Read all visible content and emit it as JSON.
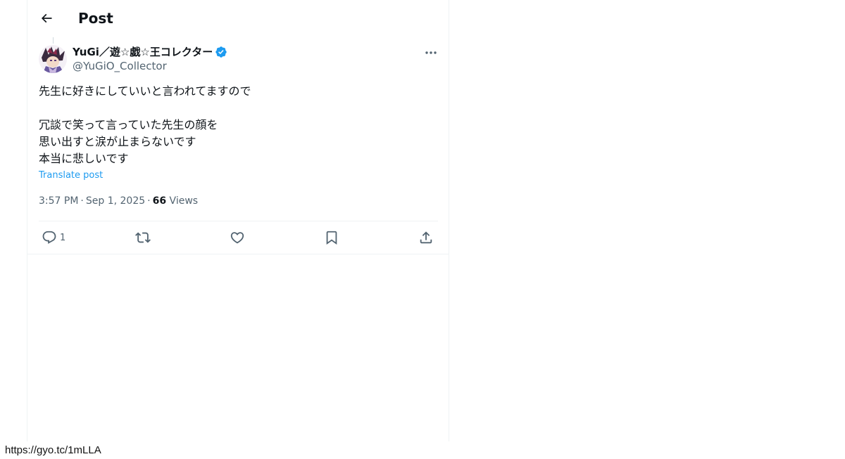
{
  "header": {
    "title": "Post",
    "back_icon": "arrow-left-icon"
  },
  "post": {
    "author": {
      "display_name": "YuGi／遊☆戯☆王コレクター",
      "handle": "@YuGiO_Collector",
      "verified": true,
      "verified_color": "#1d9bf0"
    },
    "text": "先生に好きにしていいと言われてますので\n\n冗談で笑って言っていた先生の顔を\n思い出すと涙が止まらないです\n本当に悲しいです",
    "translate_label": "Translate post",
    "time": "3:57 PM",
    "date": "Sep 1, 2025",
    "views_count": "66",
    "views_label": "Views",
    "separator": "·",
    "actions": {
      "reply_count": "1",
      "reply_icon": "reply-icon",
      "repost_icon": "repost-icon",
      "like_icon": "heart-icon",
      "bookmark_icon": "bookmark-icon",
      "share_icon": "share-icon"
    }
  },
  "colors": {
    "accent": "#1d9bf0",
    "secondary_text": "#536471",
    "primary_text": "#0f1419",
    "border": "#eff3f4"
  },
  "status_bar": {
    "url": "https://gyo.tc/1mLLA"
  }
}
